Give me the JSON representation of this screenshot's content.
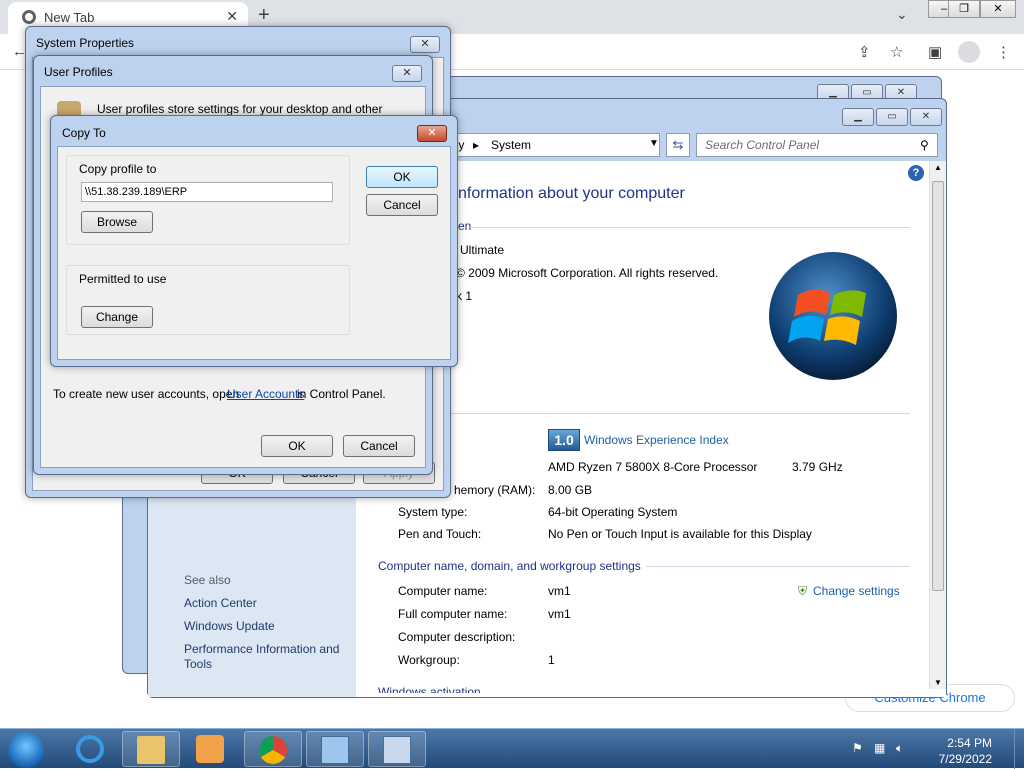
{
  "chrome": {
    "tab_title": "New Tab",
    "close_tab": "✕",
    "new_tab": "+",
    "tab_search": "⌄",
    "customize": "Customize Chrome"
  },
  "system_properties": {
    "title": "System Properties",
    "close": "✕",
    "hidden_ok": "OK",
    "hidden_cancel": "Cancel",
    "hidden_apply": "Apply"
  },
  "user_profiles": {
    "title": "User Profiles",
    "close": "✕",
    "intro": "User profiles store settings for your desktop and other",
    "footer_text_1": "To create new user accounts, open ",
    "footer_link": "User Accounts",
    "footer_text_2": " in Control Panel.",
    "ok": "OK",
    "cancel": "Cancel"
  },
  "copy_to": {
    "title": "Copy To",
    "close": "✕",
    "copy_profile_label": "Copy profile to",
    "path_value": "\\\\51.38.239.189\\ERP",
    "browse": "Browse",
    "permitted_label": "Permitted to use",
    "change": "Change",
    "ok": "OK",
    "cancel": "Cancel"
  },
  "control_panel": {
    "breadcrumb_partial": "ty",
    "breadcrumb_current": "System",
    "search_placeholder": "Search Control Panel",
    "heading": "nformation about your computer",
    "section_edition_partial": "en",
    "edition_partial": "Ultimate",
    "copyright": "© 2009 Microsoft Corporation.  All rights reserved.",
    "sp_partial": "k 1",
    "wei_score": "1.0",
    "wei_link": "Windows Experience Index",
    "processor": "AMD Ryzen 7 5800X 8-Core Processor",
    "processor_speed": "3.79 GHz",
    "ram_label": "hemory (RAM):",
    "ram_value": "8.00 GB",
    "system_type_label": "System type:",
    "system_type_value": "64-bit Operating System",
    "pen_label": "Pen and Touch:",
    "pen_value": "No Pen or Touch Input is available for this Display",
    "computer_section": "Computer name, domain, and workgroup settings",
    "computer_name_label": "Computer name:",
    "computer_name_value": "vm1",
    "full_name_label": "Full computer name:",
    "full_name_value": "vm1",
    "description_label": "Computer description:",
    "workgroup_label": "Workgroup:",
    "workgroup_value": "1",
    "change_settings": "Change settings",
    "activation_partial": "Windows activation",
    "see_also": "See also",
    "action_center": "Action Center",
    "windows_update": "Windows Update",
    "perf_info_1": "Performance Information and",
    "perf_info_2": "Tools"
  },
  "taskbar": {
    "time": "2:54 PM",
    "date": "7/29/2022"
  },
  "colors": {
    "link": "#1e3a6e",
    "heading": "#1e3287",
    "taskbar_top": "#4c78a8"
  }
}
